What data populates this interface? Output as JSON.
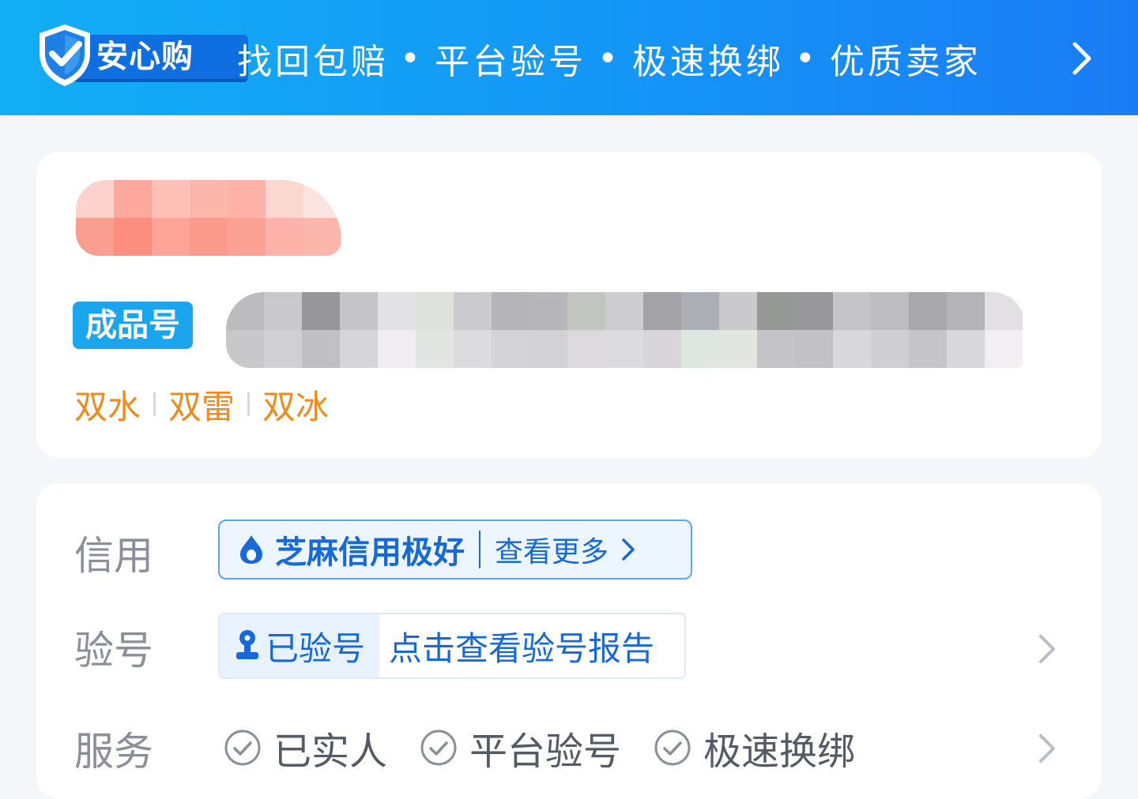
{
  "banner": {
    "brand": "安心购",
    "slogan": [
      "找回包赔",
      "平台验号",
      "极速换绑",
      "优质卖家"
    ],
    "separator": "•",
    "colors": {
      "start": "#12aef5",
      "end": "#1a7cf5"
    }
  },
  "product": {
    "badge": "成品号",
    "tags": [
      "双水",
      "双雷",
      "双冰"
    ],
    "tag_color": "#f08a1c"
  },
  "credit": {
    "label": "信用",
    "status": "芝麻信用极好",
    "more": "查看更多",
    "icon": "sesame-drop-icon"
  },
  "verification": {
    "label": "验号",
    "status": "已验号",
    "action": "点击查看验号报告",
    "icon": "person-verified-icon"
  },
  "service": {
    "label": "服务",
    "items": [
      "已实人",
      "平台验号",
      "极速换绑"
    ],
    "icon": "check-circle-icon"
  },
  "colors": {
    "accent": "#1768d8",
    "label_gray": "#8a8f99"
  }
}
